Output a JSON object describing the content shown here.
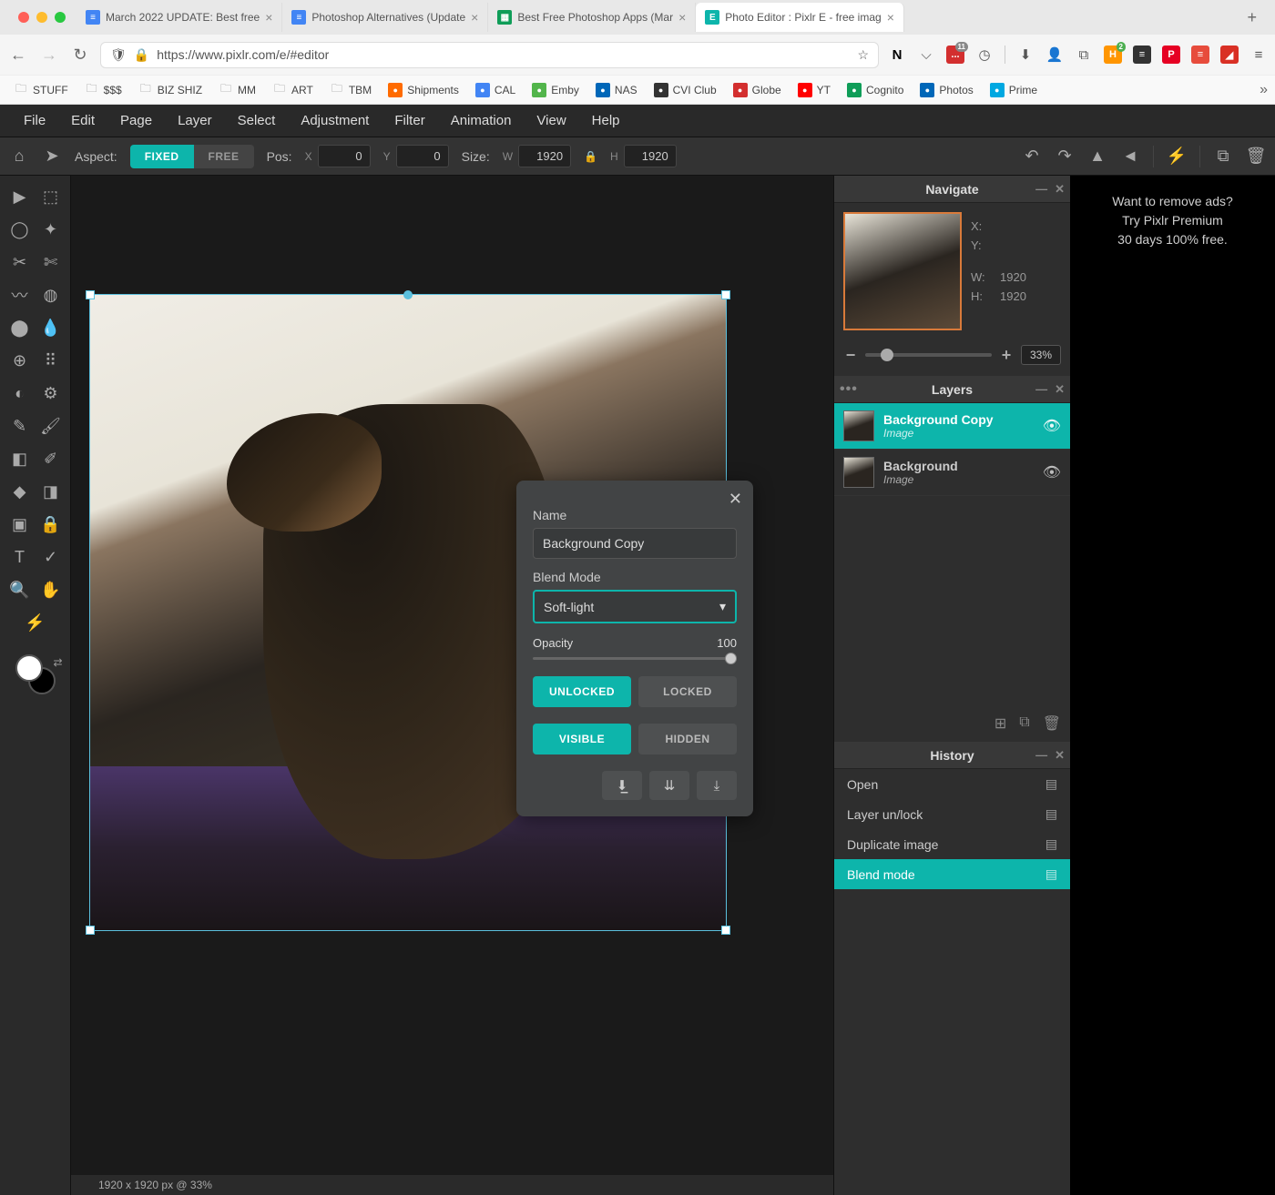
{
  "browser": {
    "tabs": [
      {
        "title": "March 2022 UPDATE: Best free",
        "favicon_bg": "#4285f4",
        "favicon_txt": "≡"
      },
      {
        "title": "Photoshop Alternatives (Update",
        "favicon_bg": "#4285f4",
        "favicon_txt": "≡"
      },
      {
        "title": "Best Free Photoshop Apps (Mar",
        "favicon_bg": "#0f9d58",
        "favicon_txt": "▦"
      },
      {
        "title": "Photo Editor : Pixlr E - free imag",
        "favicon_bg": "#0db5ab",
        "favicon_txt": "E",
        "active": true
      }
    ],
    "url": "https://www.pixlr.com/e/#editor",
    "bookmarks": [
      {
        "label": "STUFF",
        "folder": true
      },
      {
        "label": "$$$",
        "folder": true
      },
      {
        "label": "BIZ SHIZ",
        "folder": true
      },
      {
        "label": "MM",
        "folder": true
      },
      {
        "label": "ART",
        "folder": true
      },
      {
        "label": "TBM",
        "folder": true
      },
      {
        "label": "Shipments",
        "bg": "#ff6b00"
      },
      {
        "label": "CAL",
        "bg": "#4285f4"
      },
      {
        "label": "Emby",
        "bg": "#52b54b"
      },
      {
        "label": "NAS",
        "bg": "#0067b8"
      },
      {
        "label": "CVI Club",
        "bg": "#333"
      },
      {
        "label": "Globe",
        "bg": "#d32f2f"
      },
      {
        "label": "YT",
        "bg": "#ff0000"
      },
      {
        "label": "Cognito",
        "bg": "#0f9d58"
      },
      {
        "label": "Photos",
        "bg": "#0067b8"
      },
      {
        "label": "Prime",
        "bg": "#00a8e1"
      }
    ]
  },
  "menubar": [
    "File",
    "Edit",
    "Page",
    "Layer",
    "Select",
    "Adjustment",
    "Filter",
    "Animation",
    "View",
    "Help"
  ],
  "toolbar": {
    "aspect_label": "Aspect:",
    "aspect_fixed": "FIXED",
    "aspect_free": "FREE",
    "pos_label": "Pos:",
    "pos_x_label": "X",
    "pos_x": "0",
    "pos_y_label": "Y",
    "pos_y": "0",
    "size_label": "Size:",
    "size_w_label": "W",
    "size_w": "1920",
    "size_h_label": "H",
    "size_h": "1920"
  },
  "panels": {
    "navigate": {
      "title": "Navigate",
      "x_label": "X:",
      "y_label": "Y:",
      "w_label": "W:",
      "w": "1920",
      "h_label": "H:",
      "h": "1920",
      "zoom": "33%"
    },
    "layers": {
      "title": "Layers",
      "items": [
        {
          "name": "Background Copy",
          "type": "Image",
          "active": true
        },
        {
          "name": "Background",
          "type": "Image"
        }
      ]
    },
    "history": {
      "title": "History",
      "items": [
        {
          "label": "Open"
        },
        {
          "label": "Layer un/lock"
        },
        {
          "label": "Duplicate image"
        },
        {
          "label": "Blend mode",
          "active": true
        }
      ]
    }
  },
  "dialog": {
    "name_label": "Name",
    "name_value": "Background Copy",
    "blend_label": "Blend Mode",
    "blend_value": "Soft-light",
    "opacity_label": "Opacity",
    "opacity_value": "100",
    "unlocked": "UNLOCKED",
    "locked": "LOCKED",
    "visible": "VISIBLE",
    "hidden": "HIDDEN"
  },
  "statusbar": "1920 x 1920 px @ 33%",
  "ad": {
    "line1": "Want to remove ads?",
    "line2": "Try Pixlr Premium",
    "line3": "30 days 100% free."
  }
}
